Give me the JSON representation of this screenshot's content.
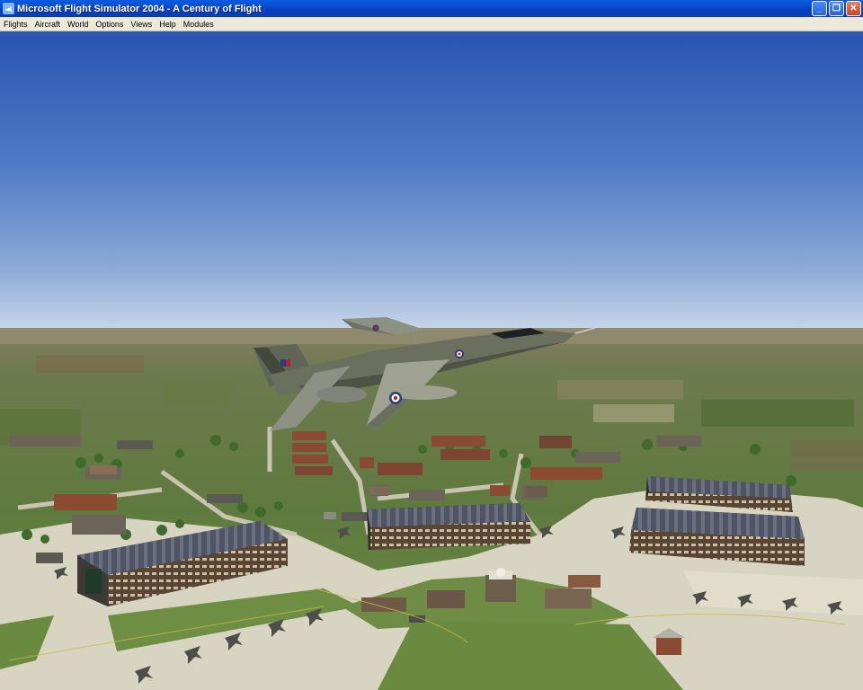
{
  "window": {
    "title": "Microsoft Flight Simulator 2004 - A Century of Flight",
    "controls": {
      "minimize": "_",
      "maximize": "❐",
      "close": "✕"
    }
  },
  "menu": {
    "items": [
      "Flights",
      "Aircraft",
      "World",
      "Options",
      "Views",
      "Help",
      "Modules"
    ]
  },
  "scene": {
    "description_icons": [
      "aircraft-roundel-icon"
    ],
    "colors": {
      "sky_top": "#2d59b4",
      "sky_horizon": "#c2d4e6",
      "grass": "#6f8a4e",
      "apron": "#d9d6c4",
      "hangar_roof": "#4d5566"
    }
  }
}
